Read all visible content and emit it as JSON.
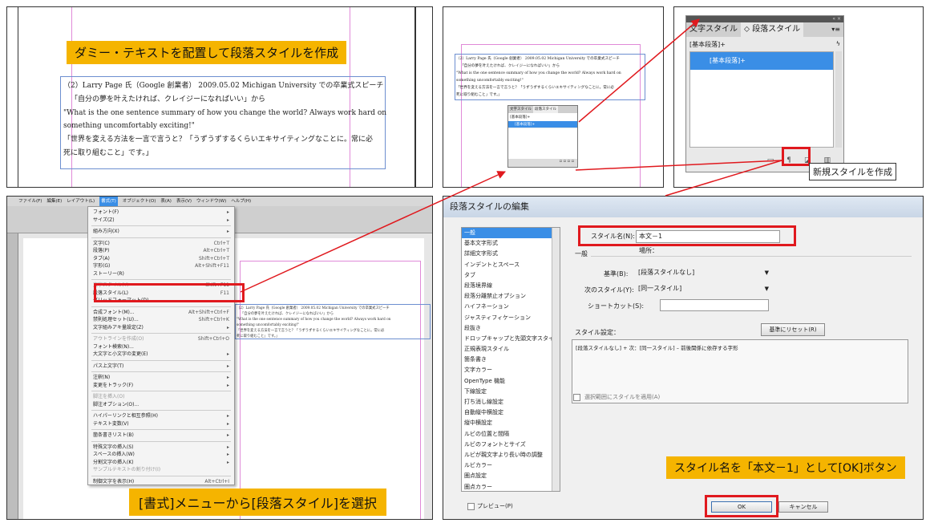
{
  "panel_top_left": {
    "callout": "ダミー・テキストを配置して段落スタイルを作成",
    "text_lines": [
      "（2）Larry Page 氏（Google 創業者） 2009.05.02 Michigan University での卒業式スピーチ",
      "「自分の夢を叶えたければ、クレイジーになればいい」から",
      "\"What is the one sentence summary of how you change the world? Always work hard on",
      "something uncomfortably exciting!\"",
      "「世界を変える方法を一言で言うと？「うずうずするくらいエキサイティングなことに。常に必",
      "死に取り組むこと」です。」"
    ]
  },
  "panel_top_mid": {
    "text_lines": [
      "（2）Larry Page 氏（Google 創業者） 2009.05.02 Michigan University での卒業式スピーチ",
      "「自分の夢を叶えたければ、クレイジーになればいい」から",
      "\"What is the one sentence summary of how you change the world? Always work hard on",
      "something uncomfortably exciting!\"",
      "「世界を変える方法を一言で言うと？「うずうずするくらいエキサイティングなことに。常に必",
      "死に取り組むこと」です。」"
    ],
    "mini_tabs": [
      "文字スタイル",
      "段落スタイル"
    ],
    "mini_items": [
      "[基本段落]+",
      "[基本段落]+"
    ]
  },
  "panel_top_right": {
    "tab_char": "文字スタイル",
    "tab_para": "段落スタイル",
    "header_item": "[基本段落]+",
    "selected_item": "[基本段落]+",
    "callout": "新規スタイルを作成"
  },
  "panel_bottom_left": {
    "menubar": [
      "ファイル(F)",
      "編集(E)",
      "レイアウト(L)",
      "書式(T)",
      "オブジェクト(O)",
      "表(A)",
      "表示(V)",
      "ウィンドウ(W)",
      "ヘルプ(H)"
    ],
    "menu_items": [
      {
        "label": "フォント(F)",
        "key": "▸"
      },
      {
        "label": "サイズ(Z)",
        "key": "▸"
      },
      {
        "label": "組み方向(X)",
        "key": "▸"
      },
      {
        "label": "文字(C)",
        "key": "Ctrl+T"
      },
      {
        "label": "段落(P)",
        "key": "Alt+Ctrl+T"
      },
      {
        "label": "タブ(A)",
        "key": "Shift+Ctrl+T"
      },
      {
        "label": "字形(G)",
        "key": "Alt+Shift+F11"
      },
      {
        "label": "ストーリー(R)",
        "key": ""
      },
      {
        "label": "文字スタイル(Y)",
        "key": "Shift+F11"
      },
      {
        "label": "段落スタイル(L)",
        "key": "F11"
      },
      {
        "label": "グリッドフォーマット(D)",
        "key": ""
      },
      {
        "label": "合成フォント(M)...",
        "key": "Alt+Shift+Ctrl+F"
      },
      {
        "label": "禁則処理セット(U)...",
        "key": "Shift+Ctrl+K"
      },
      {
        "label": "文字組みアキ量設定(Z)",
        "key": "▸"
      },
      {
        "label": "アウトラインを作成(O)",
        "key": "Shift+Ctrl+O"
      },
      {
        "label": "フォント検索(N)...",
        "key": ""
      },
      {
        "label": "大文字と小文字の変更(E)",
        "key": "▸"
      },
      {
        "label": "パス上文字(T)",
        "key": "▸"
      },
      {
        "label": "注釈(N)",
        "key": "▸"
      },
      {
        "label": "変更をトラック(F)",
        "key": "▸"
      },
      {
        "label": "脚注を挿入(O)",
        "key": ""
      },
      {
        "label": "脚注オプション(O)...",
        "key": ""
      },
      {
        "label": "ハイパーリンクと相互参照(H)",
        "key": "▸"
      },
      {
        "label": "テキスト変数(V)",
        "key": "▸"
      },
      {
        "label": "箇条書きリスト(B)",
        "key": "▸"
      },
      {
        "label": "特殊文字の挿入(S)",
        "key": "▸"
      },
      {
        "label": "スペースの挿入(W)",
        "key": "▸"
      },
      {
        "label": "分割文字の挿入(K)",
        "key": "▸"
      },
      {
        "label": "サンプルテキストの割り付け(I)",
        "key": ""
      },
      {
        "label": "制御文字を表示(H)",
        "key": "Alt+Ctrl+I"
      }
    ],
    "callout": "[書式]メニューから[段落スタイル]を選択"
  },
  "dialog": {
    "title": "段落スタイルの編集",
    "categories": [
      "一般",
      "基本文字形式",
      "詳細文字形式",
      "インデントとスペース",
      "タブ",
      "段落境界線",
      "段落分離禁止オプション",
      "ハイフネーション",
      "ジャスティフィケーション",
      "段抜き",
      "ドロップキャップと先頭文字スタイル",
      "正規表現スタイル",
      "箇条書き",
      "文字カラー",
      "OpenType 機能",
      "下線設定",
      "打ち消し線設定",
      "自動縦中横設定",
      "縦中横設定",
      "ルビの位置と間隔",
      "ルビのフォントとサイズ",
      "ルビが親文字より長い時の調整",
      "ルビカラー",
      "圏点設定",
      "圏点カラー"
    ],
    "style_name_label": "スタイル名(N):",
    "style_name_value": "本文－1",
    "location_label": "場所：",
    "section_title": "一般",
    "based_on_label": "基準(B):",
    "based_on_value": "[段落スタイルなし]",
    "next_style_label": "次のスタイル(Y):",
    "next_style_value": "[同一スタイル]",
    "shortcut_label": "ショートカット(S):",
    "style_settings_label": "スタイル設定：",
    "reset_button": "基準にリセット(R)",
    "settings_text": "[段落スタイルなし] + 次：[同一スタイル] – 前後関係に依存する字形",
    "apply_checkbox": "選択範囲にスタイルを適用(A)",
    "preview_label": "プレビュー(P)",
    "ok_button": "OK",
    "cancel_button": "キャンセル",
    "callout": "スタイル名を「本文－1」として[OK]ボタン"
  },
  "colors": {
    "callout": "#f5b400",
    "highlight": "#e0191e",
    "selection": "#3a8ee6"
  }
}
